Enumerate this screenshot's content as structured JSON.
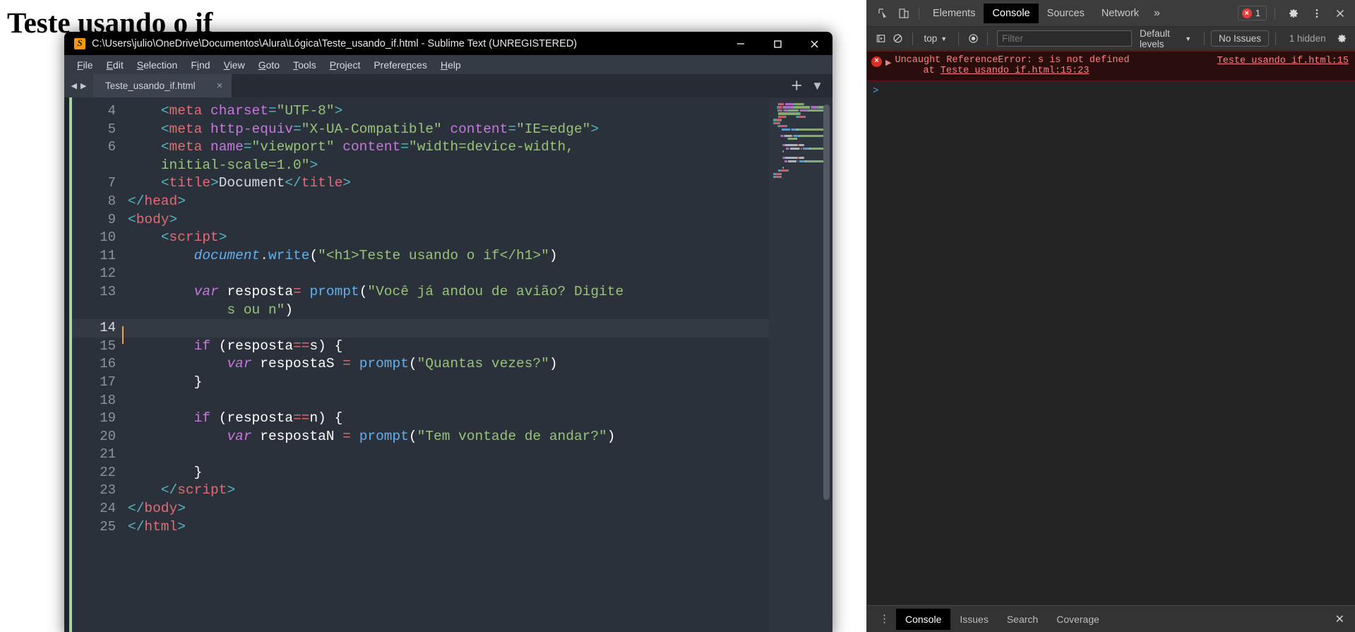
{
  "browser_page": {
    "heading": "Teste usando o if"
  },
  "sublime": {
    "title": "C:\\Users\\julio\\OneDrive\\Documentos\\Alura\\Lógica\\Teste_usando_if.html - Sublime Text (UNREGISTERED)",
    "app_icon": "sublime-text-icon",
    "window_controls": {
      "minimize": "minimize-icon",
      "maximize": "maximize-icon",
      "close": "close-icon"
    },
    "menu": [
      "File",
      "Edit",
      "Selection",
      "Find",
      "View",
      "Goto",
      "Tools",
      "Project",
      "Preferences",
      "Help"
    ],
    "tab": {
      "label": "Teste_usando_if.html",
      "close": "×",
      "nav_prev": "◀",
      "nav_next": "▶",
      "new_tab": "+",
      "tab_menu": "▼"
    },
    "current_line": 14,
    "code_lines": [
      {
        "n": 4,
        "tokens": [
          {
            "t": "    ",
            "c": "plain"
          },
          {
            "t": "<",
            "c": "punc"
          },
          {
            "t": "meta",
            "c": "tag"
          },
          {
            "t": " ",
            "c": "plain"
          },
          {
            "t": "charset",
            "c": "attr"
          },
          {
            "t": "=",
            "c": "punc"
          },
          {
            "t": "\"UTF-8\"",
            "c": "str"
          },
          {
            "t": ">",
            "c": "punc"
          }
        ]
      },
      {
        "n": 5,
        "tokens": [
          {
            "t": "    ",
            "c": "plain"
          },
          {
            "t": "<",
            "c": "punc"
          },
          {
            "t": "meta",
            "c": "tag"
          },
          {
            "t": " ",
            "c": "plain"
          },
          {
            "t": "http-equiv",
            "c": "attr"
          },
          {
            "t": "=",
            "c": "punc"
          },
          {
            "t": "\"X-UA-Compatible\"",
            "c": "str"
          },
          {
            "t": " ",
            "c": "plain"
          },
          {
            "t": "content",
            "c": "attr"
          },
          {
            "t": "=",
            "c": "punc"
          },
          {
            "t": "\"IE=edge\"",
            "c": "str"
          },
          {
            "t": ">",
            "c": "punc"
          }
        ]
      },
      {
        "n": 6,
        "tokens": [
          {
            "t": "    ",
            "c": "plain"
          },
          {
            "t": "<",
            "c": "punc"
          },
          {
            "t": "meta",
            "c": "tag"
          },
          {
            "t": " ",
            "c": "plain"
          },
          {
            "t": "name",
            "c": "attr"
          },
          {
            "t": "=",
            "c": "punc"
          },
          {
            "t": "\"viewport\"",
            "c": "str"
          },
          {
            "t": " ",
            "c": "plain"
          },
          {
            "t": "content",
            "c": "attr"
          },
          {
            "t": "=",
            "c": "punc"
          },
          {
            "t": "\"width=device-width,",
            "c": "str"
          }
        ]
      },
      {
        "n": "",
        "tokens": [
          {
            "t": "    ",
            "c": "plain"
          },
          {
            "t": "initial-scale=1.0\"",
            "c": "str"
          },
          {
            "t": ">",
            "c": "punc"
          }
        ]
      },
      {
        "n": 7,
        "tokens": [
          {
            "t": "    ",
            "c": "plain"
          },
          {
            "t": "<",
            "c": "punc"
          },
          {
            "t": "title",
            "c": "tag"
          },
          {
            "t": ">",
            "c": "punc"
          },
          {
            "t": "Document",
            "c": "plain"
          },
          {
            "t": "</",
            "c": "punc"
          },
          {
            "t": "title",
            "c": "tag"
          },
          {
            "t": ">",
            "c": "punc"
          }
        ]
      },
      {
        "n": 8,
        "tokens": [
          {
            "t": "</",
            "c": "punc"
          },
          {
            "t": "head",
            "c": "tag"
          },
          {
            "t": ">",
            "c": "punc"
          }
        ]
      },
      {
        "n": 9,
        "tokens": [
          {
            "t": "<",
            "c": "punc"
          },
          {
            "t": "body",
            "c": "tag"
          },
          {
            "t": ">",
            "c": "punc"
          }
        ]
      },
      {
        "n": 10,
        "tokens": [
          {
            "t": "    ",
            "c": "plain"
          },
          {
            "t": "<",
            "c": "punc"
          },
          {
            "t": "script",
            "c": "tag"
          },
          {
            "t": ">",
            "c": "punc"
          }
        ]
      },
      {
        "n": 11,
        "tokens": [
          {
            "t": "        ",
            "c": "plain"
          },
          {
            "t": "document",
            "c": "obj"
          },
          {
            "t": ".",
            "c": "plain"
          },
          {
            "t": "write",
            "c": "fn"
          },
          {
            "t": "(",
            "c": "white"
          },
          {
            "t": "\"<h1>Teste usando o if</h1>\"",
            "c": "str"
          },
          {
            "t": ")",
            "c": "white"
          }
        ]
      },
      {
        "n": 12,
        "tokens": []
      },
      {
        "n": 13,
        "tokens": [
          {
            "t": "        ",
            "c": "plain"
          },
          {
            "t": "var",
            "c": "kw"
          },
          {
            "t": " ",
            "c": "plain"
          },
          {
            "t": "resposta",
            "c": "white"
          },
          {
            "t": "=",
            "c": "op"
          },
          {
            "t": " ",
            "c": "plain"
          },
          {
            "t": "prompt",
            "c": "fn"
          },
          {
            "t": "(",
            "c": "white"
          },
          {
            "t": "\"Você já andou de avião? Digite",
            "c": "str"
          }
        ]
      },
      {
        "n": "",
        "tokens": [
          {
            "t": "            ",
            "c": "plain"
          },
          {
            "t": "s ou n\"",
            "c": "str"
          },
          {
            "t": ")",
            "c": "white"
          }
        ]
      },
      {
        "n": 14,
        "tokens": []
      },
      {
        "n": 15,
        "tokens": [
          {
            "t": "        ",
            "c": "plain"
          },
          {
            "t": "if",
            "c": "kw2"
          },
          {
            "t": " (",
            "c": "white"
          },
          {
            "t": "resposta",
            "c": "white"
          },
          {
            "t": "==",
            "c": "op"
          },
          {
            "t": "s",
            "c": "white"
          },
          {
            "t": ") {",
            "c": "white"
          }
        ]
      },
      {
        "n": 16,
        "tokens": [
          {
            "t": "            ",
            "c": "plain"
          },
          {
            "t": "var",
            "c": "kw"
          },
          {
            "t": " ",
            "c": "plain"
          },
          {
            "t": "respostaS",
            "c": "white"
          },
          {
            "t": " ",
            "c": "plain"
          },
          {
            "t": "=",
            "c": "op"
          },
          {
            "t": " ",
            "c": "plain"
          },
          {
            "t": "prompt",
            "c": "fn"
          },
          {
            "t": "(",
            "c": "white"
          },
          {
            "t": "\"Quantas vezes?\"",
            "c": "str"
          },
          {
            "t": ")",
            "c": "white"
          }
        ]
      },
      {
        "n": 17,
        "tokens": [
          {
            "t": "        ",
            "c": "plain"
          },
          {
            "t": "}",
            "c": "white"
          }
        ]
      },
      {
        "n": 18,
        "tokens": []
      },
      {
        "n": 19,
        "tokens": [
          {
            "t": "        ",
            "c": "plain"
          },
          {
            "t": "if",
            "c": "kw2"
          },
          {
            "t": " (",
            "c": "white"
          },
          {
            "t": "resposta",
            "c": "white"
          },
          {
            "t": "==",
            "c": "op"
          },
          {
            "t": "n",
            "c": "white"
          },
          {
            "t": ") {",
            "c": "white"
          }
        ]
      },
      {
        "n": 20,
        "tokens": [
          {
            "t": "            ",
            "c": "plain"
          },
          {
            "t": "var",
            "c": "kw"
          },
          {
            "t": " ",
            "c": "plain"
          },
          {
            "t": "respostaN",
            "c": "white"
          },
          {
            "t": " ",
            "c": "plain"
          },
          {
            "t": "=",
            "c": "op"
          },
          {
            "t": " ",
            "c": "plain"
          },
          {
            "t": "prompt",
            "c": "fn"
          },
          {
            "t": "(",
            "c": "white"
          },
          {
            "t": "\"Tem vontade de andar?\"",
            "c": "str"
          },
          {
            "t": ")",
            "c": "white"
          }
        ]
      },
      {
        "n": 21,
        "tokens": []
      },
      {
        "n": 22,
        "tokens": [
          {
            "t": "        ",
            "c": "plain"
          },
          {
            "t": "}",
            "c": "white"
          }
        ]
      },
      {
        "n": 23,
        "tokens": [
          {
            "t": "    ",
            "c": "plain"
          },
          {
            "t": "</",
            "c": "punc"
          },
          {
            "t": "script",
            "c": "tag"
          },
          {
            "t": ">",
            "c": "punc"
          }
        ]
      },
      {
        "n": 24,
        "tokens": [
          {
            "t": "</",
            "c": "punc"
          },
          {
            "t": "body",
            "c": "tag"
          },
          {
            "t": ">",
            "c": "punc"
          }
        ]
      },
      {
        "n": 25,
        "tokens": [
          {
            "t": "</",
            "c": "punc"
          },
          {
            "t": "html",
            "c": "tag"
          },
          {
            "t": ">",
            "c": "punc"
          }
        ]
      }
    ]
  },
  "devtools": {
    "tabs": [
      {
        "label": "Elements",
        "active": false
      },
      {
        "label": "Console",
        "active": true
      },
      {
        "label": "Sources",
        "active": false
      },
      {
        "label": "Network",
        "active": false
      }
    ],
    "more_tabs": "»",
    "icons": {
      "inspect": "inspect-element-icon",
      "device": "device-toolbar-icon",
      "settings": "gear-icon",
      "menu": "kebab-menu-icon",
      "close": "close-icon",
      "execute": "execute-snippet-icon",
      "clear": "clear-console-icon",
      "eye": "live-expression-icon",
      "console_settings": "console-settings-gear-icon"
    },
    "error_count": "1",
    "console_toolbar": {
      "context": "top",
      "filter_placeholder": "Filter",
      "levels": "Default levels",
      "no_issues": "No Issues",
      "hidden": "1 hidden"
    },
    "console_messages": [
      {
        "type": "error",
        "message": "Uncaught ReferenceError: s is not defined",
        "stack_prefix": "at ",
        "stack_link": "Teste_usando_if.html:15:23",
        "source_link": "Teste_usando_if.html:15"
      }
    ],
    "prompt_symbol": ">",
    "drawer_tabs": [
      {
        "label": "Console",
        "active": true
      },
      {
        "label": "Issues",
        "active": false
      },
      {
        "label": "Search",
        "active": false
      },
      {
        "label": "Coverage",
        "active": false
      }
    ]
  },
  "colors": {
    "error_red": "#ff8080",
    "accent_blue": "#5b9dd9",
    "sublime_bg": "#2b313a",
    "devtools_bg": "#242424"
  }
}
